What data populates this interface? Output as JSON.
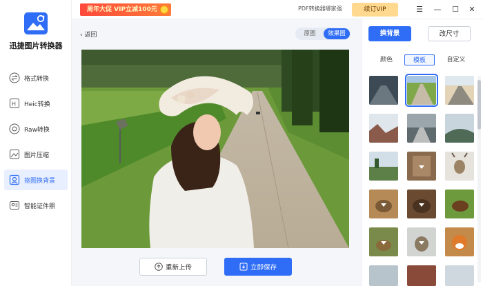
{
  "app": {
    "name": "迅捷图片转换器"
  },
  "nav": [
    {
      "label": "格式转换",
      "icon": "format-convert-icon"
    },
    {
      "label": "Heic转换",
      "icon": "heic-icon"
    },
    {
      "label": "Raw转换",
      "icon": "raw-icon"
    },
    {
      "label": "图片压缩",
      "icon": "compress-icon"
    },
    {
      "label": "抠图换背景",
      "icon": "cutout-icon",
      "active": true
    },
    {
      "label": "智能证件照",
      "icon": "id-photo-icon"
    }
  ],
  "topbar": {
    "promo": "周年大促 VIP立减100元",
    "pdf_link": "PDF转换器哪家强",
    "vip_button": "续订VIP"
  },
  "main": {
    "back": "返回",
    "view_original": "原图",
    "view_result": "效果图",
    "reupload": "重新上传",
    "save": "立即保存"
  },
  "panel": {
    "tab_background": "换背景",
    "tab_resize": "改尺寸",
    "sub_color": "颜色",
    "sub_template": "模板",
    "sub_custom": "自定义"
  },
  "colors": {
    "accent": "#2f6df6",
    "promo": "#ff4a3c",
    "vip": "#ffd990"
  }
}
